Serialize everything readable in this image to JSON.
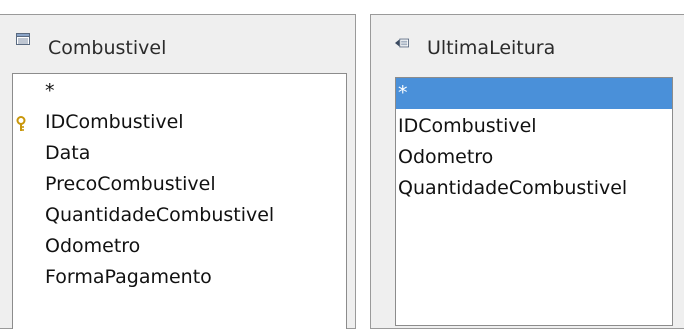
{
  "tables": [
    {
      "title": "Combustivel",
      "icon": "table-icon",
      "fields": [
        {
          "name": "*",
          "primary_key": false,
          "selected": false
        },
        {
          "name": "IDCombustivel",
          "primary_key": true,
          "selected": false
        },
        {
          "name": "Data",
          "primary_key": false,
          "selected": false
        },
        {
          "name": "PrecoCombustivel",
          "primary_key": false,
          "selected": false
        },
        {
          "name": "QuantidadeCombustivel",
          "primary_key": false,
          "selected": false
        },
        {
          "name": "Odometro",
          "primary_key": false,
          "selected": false
        },
        {
          "name": "FormaPagamento",
          "primary_key": false,
          "selected": false
        }
      ]
    },
    {
      "title": "UltimaLeitura",
      "icon": "query-icon",
      "fields": [
        {
          "name": "*",
          "primary_key": false,
          "selected": true
        },
        {
          "name": "IDCombustivel",
          "primary_key": false,
          "selected": false
        },
        {
          "name": "Odometro",
          "primary_key": false,
          "selected": false
        },
        {
          "name": "QuantidadeCombustivel",
          "primary_key": false,
          "selected": false
        }
      ]
    }
  ],
  "colors": {
    "selection": "#4a90d9",
    "window_bg": "#efefef",
    "list_bg": "#ffffff",
    "key_icon": "#e0a800"
  }
}
